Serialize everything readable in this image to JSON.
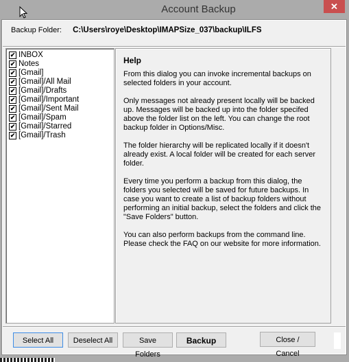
{
  "window": {
    "title": "Account Backup",
    "close_icon": "close-icon"
  },
  "backup_folder": {
    "label": "Backup Folder:",
    "path": "C:\\Users\\roye\\Desktop\\IMAPSize_037\\backup\\ILFS"
  },
  "folders": [
    {
      "name": "INBOX",
      "checked": true
    },
    {
      "name": "Notes",
      "checked": true
    },
    {
      "name": "[Gmail]",
      "checked": true
    },
    {
      "name": "[Gmail]/All Mail",
      "checked": true
    },
    {
      "name": "[Gmail]/Drafts",
      "checked": true
    },
    {
      "name": "[Gmail]/Important",
      "checked": true
    },
    {
      "name": "[Gmail]/Sent Mail",
      "checked": true
    },
    {
      "name": "[Gmail]/Spam",
      "checked": true
    },
    {
      "name": "[Gmail]/Starred",
      "checked": true
    },
    {
      "name": "[Gmail]/Trash",
      "checked": true
    }
  ],
  "help": {
    "title": "Help",
    "paragraphs": [
      "From this dialog you can invoke incremental backups on selected folders in your account.",
      "Only messages not already present locally will be backed up. Messages will be backed up into the folder specifed above the folder list on the left. You can change the root backup folder in Options/Misc.",
      "The folder hierarchy will be replicated locally if it doesn't already exist. A local folder will be created for each server folder.",
      "Every time you perform a backup from this dialog, the folders you selected will be saved for future backups. In case you want to create a list of backup folders without performing an initial backup, select the folders and click the \"Save Folders\" button.",
      "You can also perform backups from the command line. Please check the FAQ on our website for more information."
    ]
  },
  "buttons": {
    "select_all": "Select All",
    "deselect_all": "Deselect All",
    "save_folders": "Save Folders",
    "backup": "Backup",
    "close_cancel": "Close / Cancel"
  },
  "check_glyph": "✔",
  "close_glyph": "✕"
}
